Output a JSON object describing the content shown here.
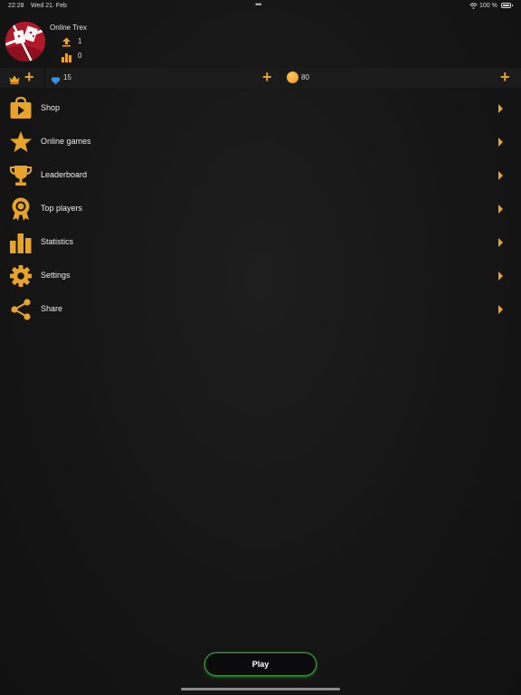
{
  "status_bar": {
    "time": "22:28",
    "date": "Wed 21. Feb",
    "battery": "100 %"
  },
  "profile": {
    "name": "Online Trex",
    "stat_up": "1",
    "stat_rank": "0"
  },
  "currency": {
    "gems": "15",
    "coins": "80"
  },
  "menu": [
    {
      "label": "Shop",
      "icon": "shop-icon"
    },
    {
      "label": "Online games",
      "icon": "star-icon"
    },
    {
      "label": "Leaderboard",
      "icon": "trophy-icon"
    },
    {
      "label": "Top players",
      "icon": "medal-icon"
    },
    {
      "label": "Statistics",
      "icon": "bar-chart-icon"
    },
    {
      "label": "Settings",
      "icon": "gear-icon"
    },
    {
      "label": "Share",
      "icon": "share-icon"
    }
  ],
  "play_label": "Play",
  "colors": {
    "accent": "#e8a32a",
    "glow": "#3cbf3c",
    "background": "#161616"
  }
}
